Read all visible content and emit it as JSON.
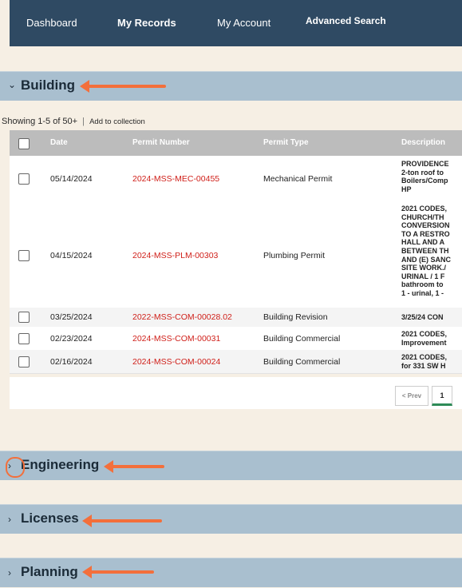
{
  "nav": {
    "dashboard": "Dashboard",
    "my_records": "My Records",
    "my_account": "My Account",
    "advanced_search": "Advanced Search"
  },
  "sections": {
    "building": "Building",
    "engineering": "Engineering",
    "licenses": "Licenses",
    "planning": "Planning"
  },
  "listing": {
    "showing": "Showing 1-5 of 50+",
    "separator": "|",
    "add_to_collection": "Add to collection"
  },
  "table": {
    "headers": [
      "Date",
      "Permit Number",
      "Permit Type",
      "Description"
    ],
    "rows": [
      {
        "date": "05/14/2024",
        "permit_number": "2024-MSS-MEC-00455",
        "permit_type": "Mechanical Permit",
        "description": "PROVIDENCE\n2-ton roof to\nBoilers/Comp\nHP"
      },
      {
        "date": "04/15/2024",
        "permit_number": "2024-MSS-PLM-00303",
        "permit_type": "Plumbing Permit",
        "description": "2021 CODES,\nCHURCH/TH\nCONVERSION\nTO A RESTRO\nHALL AND A\nBETWEEN TH\nAND (E) SANC\nSITE WORK./\nURINAL / 1 F\nbathroom to\n1 - urinal, 1 -"
      },
      {
        "date": "03/25/2024",
        "permit_number": "2022-MSS-COM-00028.02",
        "permit_type": "Building Revision",
        "description": "3/25/24 CON"
      },
      {
        "date": "02/23/2024",
        "permit_number": "2024-MSS-COM-00031",
        "permit_type": "Building Commercial",
        "description": "2021 CODES,\nImprovement"
      },
      {
        "date": "02/16/2024",
        "permit_number": "2024-MSS-COM-00024",
        "permit_type": "Building Commercial",
        "description": "2021 CODES,\nfor 331 SW H"
      }
    ]
  },
  "pagination": {
    "prev": "< Prev",
    "current_page": "1"
  },
  "colors": {
    "nav_bg": "#2f4a63",
    "section_bg": "#a9bfcf",
    "permit_link": "#d0201a",
    "annotation_arrow": "#f36f3b",
    "page_bg": "#f6efe4"
  }
}
